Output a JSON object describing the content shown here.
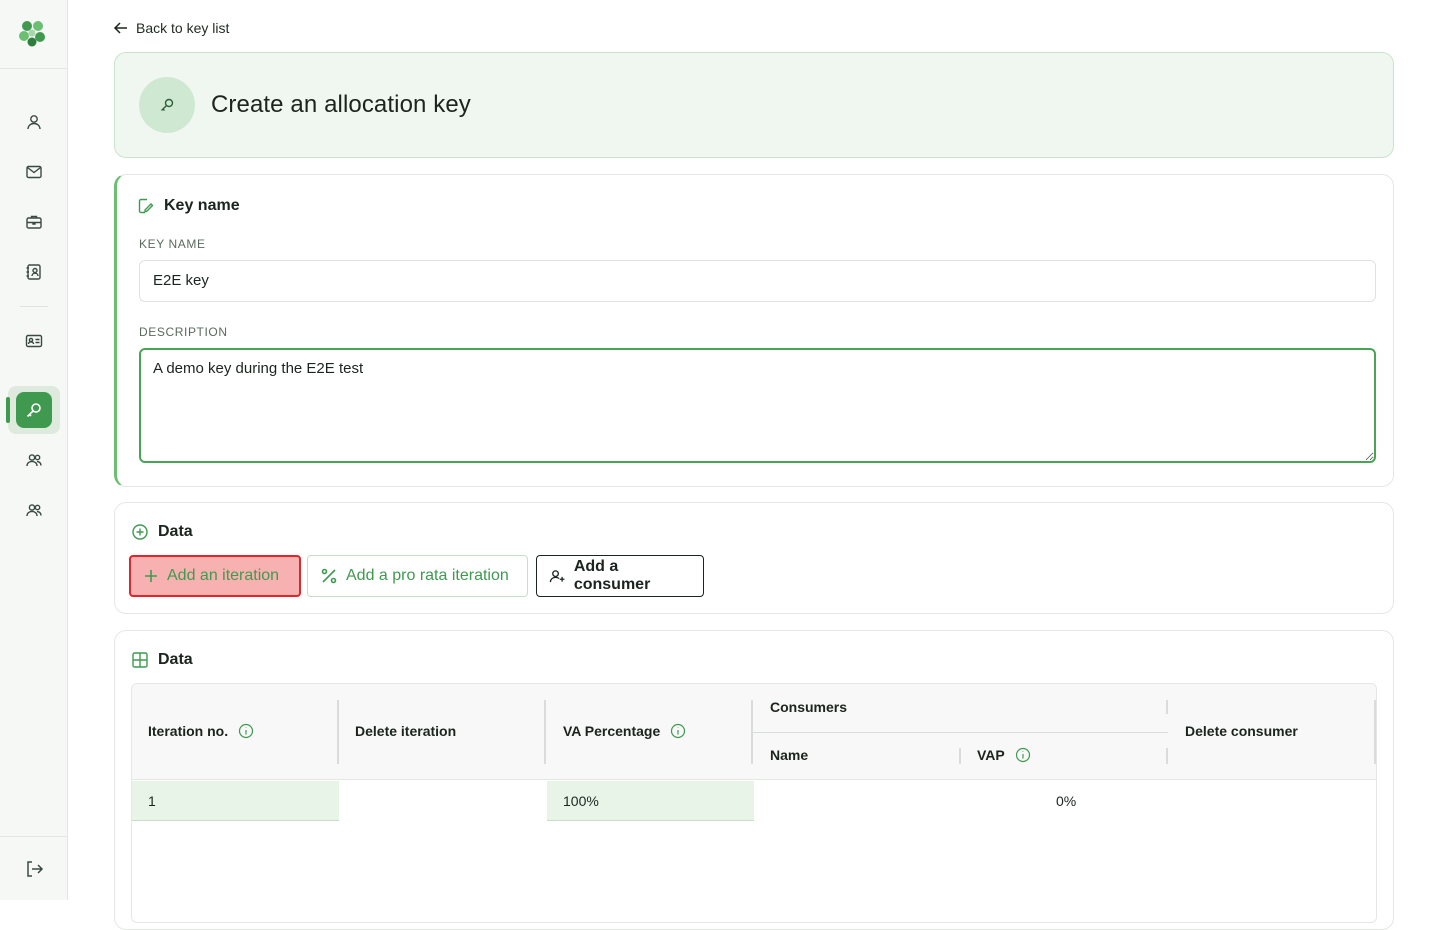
{
  "nav": {
    "back_label": "Back to key list",
    "items": [
      {
        "icon": "user-icon"
      },
      {
        "icon": "mail-icon"
      },
      {
        "icon": "briefcase-icon"
      },
      {
        "icon": "contact-book-icon"
      },
      {
        "icon": "id-card-icon"
      },
      {
        "icon": "key-icon",
        "active": true
      },
      {
        "icon": "users-icon"
      },
      {
        "icon": "users-icon"
      }
    ],
    "logout_icon": "logout-icon"
  },
  "header": {
    "title": "Create an allocation key",
    "icon": "key-icon"
  },
  "key_name_section": {
    "title": "Key name",
    "key_name_label": "KEY NAME",
    "key_name_value": "E2E key",
    "description_label": "DESCRIPTION",
    "description_value": "A demo key during the E2E test"
  },
  "actions_section": {
    "title": "Data",
    "add_iteration_label": "Add an iteration",
    "add_pro_rata_label": "Add a pro rata iteration",
    "add_consumer_label": "Add a consumer"
  },
  "table_section": {
    "title": "Data",
    "headers": {
      "iteration_no": "Iteration no.",
      "delete_iteration": "Delete iteration",
      "va_percentage": "VA Percentage",
      "consumers": "Consumers",
      "name": "Name",
      "vap": "VAP",
      "delete_consumer": "Delete consumer"
    },
    "rows": [
      {
        "iteration_no": "1",
        "va_percentage": "100%",
        "vap": "0%"
      }
    ]
  },
  "colors": {
    "accent": "#3f9a4f",
    "highlight_fill": "#f7b1b0",
    "highlight_border": "#e2252b"
  }
}
